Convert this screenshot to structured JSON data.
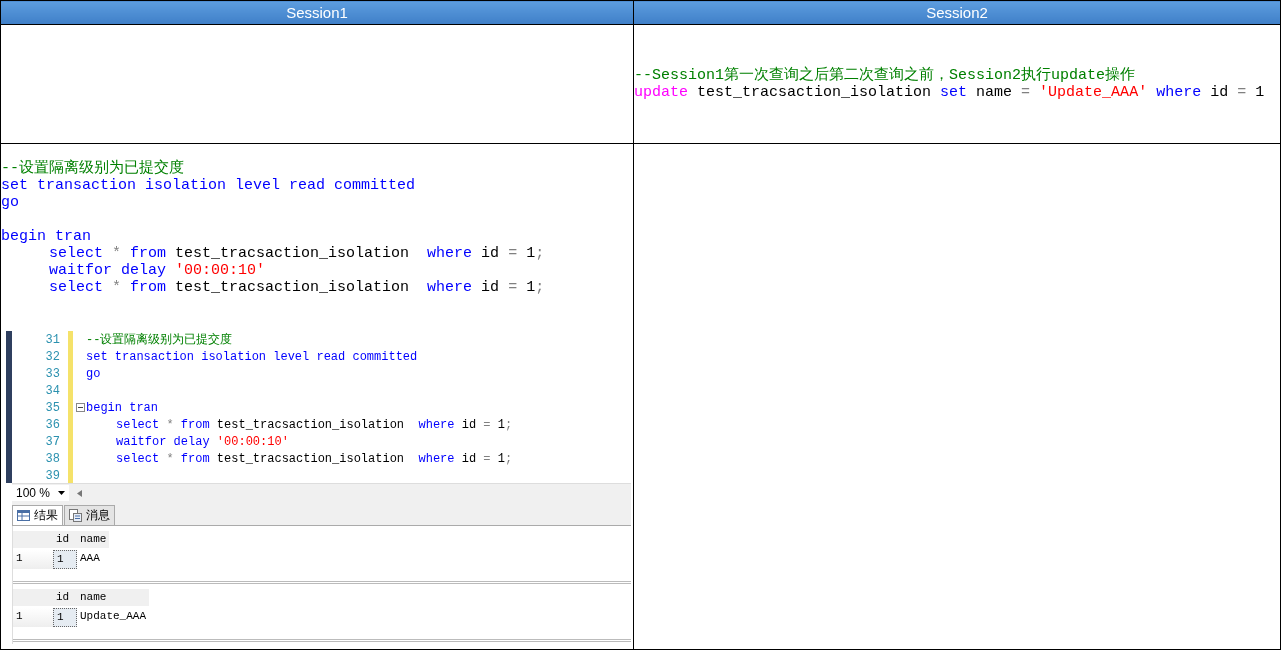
{
  "columns": [
    {
      "title": "Session1"
    },
    {
      "title": "Session2"
    }
  ],
  "rows": [
    {
      "session2": {
        "code": [
          {
            "indent": false,
            "tokens": [
              {
                "kind": "comment",
                "text": "--Session1第一次查询之后第二次查询之前，Session2执行update操作"
              }
            ]
          },
          {
            "indent": false,
            "tokens": [
              {
                "kind": "function",
                "text": "update"
              },
              {
                "kind": "plain",
                "text": " test_tracsaction_isolation "
              },
              {
                "kind": "keyword",
                "text": "set"
              },
              {
                "kind": "plain",
                "text": " name "
              },
              {
                "kind": "operator",
                "text": "="
              },
              {
                "kind": "string",
                "text": " 'Update_AAA' "
              },
              {
                "kind": "keyword",
                "text": "where"
              },
              {
                "kind": "plain",
                "text": " id "
              },
              {
                "kind": "operator",
                "text": "="
              },
              {
                "kind": "plain",
                "text": " 1"
              }
            ]
          }
        ]
      }
    },
    {
      "session1": {
        "code": [
          {
            "indent": false,
            "tokens": [
              {
                "kind": "comment",
                "text": "--设置隔离级别为已提交度"
              }
            ]
          },
          {
            "indent": false,
            "tokens": [
              {
                "kind": "keyword",
                "text": "set transaction isolation level read committed"
              }
            ]
          },
          {
            "indent": false,
            "tokens": [
              {
                "kind": "keyword",
                "text": "go"
              }
            ]
          },
          {
            "kind": "blank"
          },
          {
            "indent": false,
            "tokens": [
              {
                "kind": "keyword",
                "text": "begin tran"
              }
            ]
          },
          {
            "indent": true,
            "tokens": [
              {
                "kind": "keyword",
                "text": "select"
              },
              {
                "kind": "operator",
                "text": " * "
              },
              {
                "kind": "keyword",
                "text": "from"
              },
              {
                "kind": "plain",
                "text": " test_tracsaction_isolation  "
              },
              {
                "kind": "keyword",
                "text": "where"
              },
              {
                "kind": "plain",
                "text": " id "
              },
              {
                "kind": "operator",
                "text": "="
              },
              {
                "kind": "plain",
                "text": " 1"
              },
              {
                "kind": "operator",
                "text": ";"
              }
            ]
          },
          {
            "indent": true,
            "tokens": [
              {
                "kind": "keyword",
                "text": "waitfor delay"
              },
              {
                "kind": "string",
                "text": " '00:00:10'"
              }
            ]
          },
          {
            "indent": true,
            "tokens": [
              {
                "kind": "keyword",
                "text": "select"
              },
              {
                "kind": "operator",
                "text": " * "
              },
              {
                "kind": "keyword",
                "text": "from"
              },
              {
                "kind": "plain",
                "text": " test_tracsaction_isolation  "
              },
              {
                "kind": "keyword",
                "text": "where"
              },
              {
                "kind": "plain",
                "text": " id "
              },
              {
                "kind": "operator",
                "text": "="
              },
              {
                "kind": "plain",
                "text": " 1"
              },
              {
                "kind": "operator",
                "text": ";"
              }
            ]
          }
        ],
        "screenshot": {
          "editor": [
            {
              "number": "31",
              "fold": false,
              "indent": false,
              "tokens": [
                {
                  "kind": "comment",
                  "text": "--设置隔离级别为已提交度"
                }
              ]
            },
            {
              "number": "32",
              "fold": false,
              "indent": false,
              "tokens": [
                {
                  "kind": "keyword",
                  "text": "set transaction isolation level read committed"
                }
              ]
            },
            {
              "number": "33",
              "fold": false,
              "indent": false,
              "tokens": [
                {
                  "kind": "keyword",
                  "text": "go"
                }
              ]
            },
            {
              "number": "34",
              "fold": false
            },
            {
              "number": "35",
              "fold": true,
              "indent": false,
              "tokens": [
                {
                  "kind": "keyword",
                  "text": "begin tran"
                }
              ]
            },
            {
              "number": "36",
              "fold": false,
              "indent": true,
              "tokens": [
                {
                  "kind": "keyword",
                  "text": "select"
                },
                {
                  "kind": "operator",
                  "text": " * "
                },
                {
                  "kind": "keyword",
                  "text": "from"
                },
                {
                  "kind": "plain",
                  "text": " test_tracsaction_isolation  "
                },
                {
                  "kind": "keyword",
                  "text": "where"
                },
                {
                  "kind": "plain",
                  "text": " id "
                },
                {
                  "kind": "operator",
                  "text": "="
                },
                {
                  "kind": "plain",
                  "text": " 1"
                },
                {
                  "kind": "operator",
                  "text": ";"
                }
              ]
            },
            {
              "number": "37",
              "fold": false,
              "indent": true,
              "tokens": [
                {
                  "kind": "keyword",
                  "text": "waitfor delay"
                },
                {
                  "kind": "string",
                  "text": " '00:00:10'"
                }
              ]
            },
            {
              "number": "38",
              "fold": false,
              "indent": true,
              "tokens": [
                {
                  "kind": "keyword",
                  "text": "select"
                },
                {
                  "kind": "operator",
                  "text": " * "
                },
                {
                  "kind": "keyword",
                  "text": "from"
                },
                {
                  "kind": "plain",
                  "text": " test_tracsaction_isolation  "
                },
                {
                  "kind": "keyword",
                  "text": "where"
                },
                {
                  "kind": "plain",
                  "text": " id "
                },
                {
                  "kind": "operator",
                  "text": "="
                },
                {
                  "kind": "plain",
                  "text": " 1"
                },
                {
                  "kind": "operator",
                  "text": ";"
                }
              ]
            },
            {
              "number": "39",
              "fold": false
            }
          ],
          "zoom": "100 %",
          "result_tabs": [
            {
              "label": "结果",
              "kind": "grid",
              "selected": true
            },
            {
              "label": "消息",
              "kind": "messages",
              "selected": false
            }
          ],
          "result_grids": [
            {
              "columns": [
                "id",
                "name"
              ],
              "rows": [
                {
                  "row_number": "1",
                  "cells": [
                    "1",
                    "AAA"
                  ]
                }
              ]
            },
            {
              "columns": [
                "id",
                "name"
              ],
              "rows": [
                {
                  "row_number": "1",
                  "cells": [
                    "1",
                    "Update_AAA"
                  ]
                }
              ]
            }
          ]
        }
      }
    }
  ]
}
